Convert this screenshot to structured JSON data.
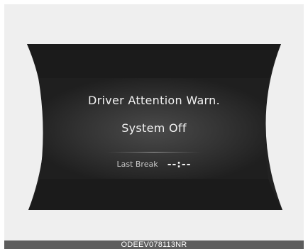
{
  "display": {
    "message_line1": "Driver Attention Warn.",
    "message_line2": "System Off",
    "last_break_label": "Last Break",
    "last_break_value": "--:--"
  },
  "caption": "ODEEV078113NR",
  "colors": {
    "background": "#efefef",
    "display_dark": "#1e1e1e",
    "display_mid": "#3a3a3a",
    "text": "#f2f2f2",
    "caption_bar": "#5d5d5d"
  }
}
